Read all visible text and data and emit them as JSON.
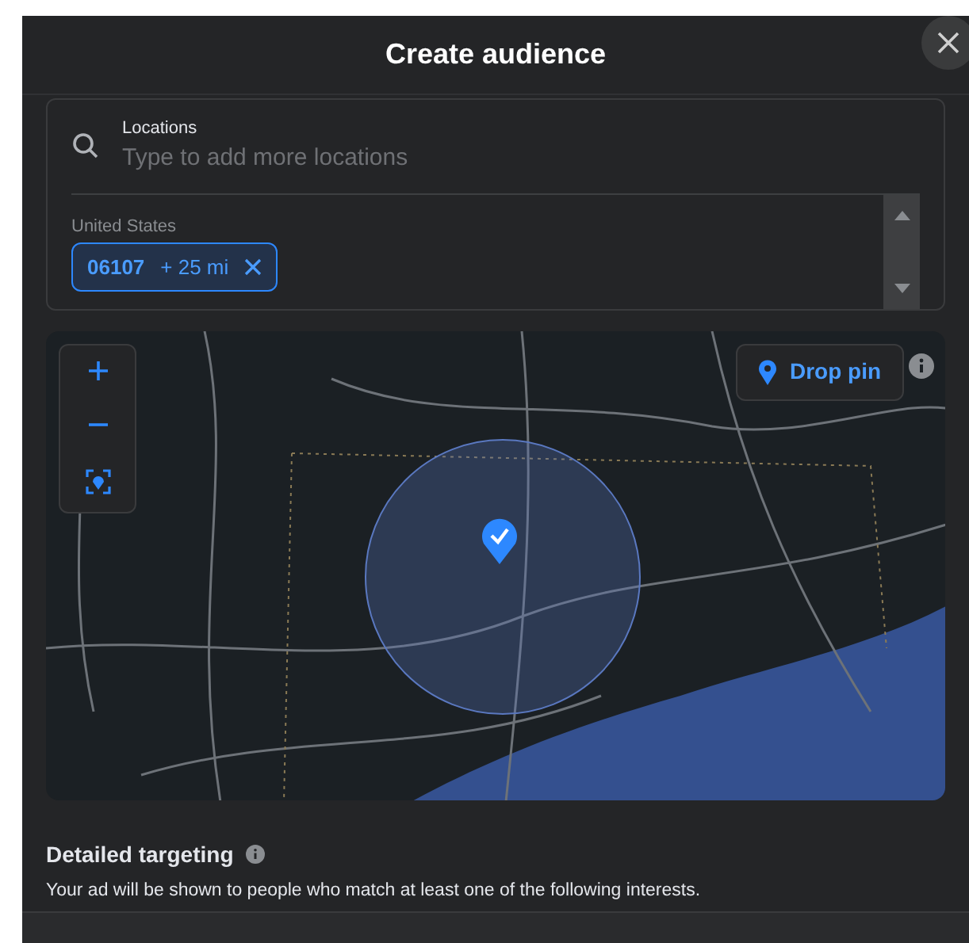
{
  "dialog": {
    "title": "Create audience"
  },
  "locations": {
    "label": "Locations",
    "placeholder": "Type to add more locations",
    "country": "United States",
    "chips": [
      {
        "code": "06107",
        "radius": "+ 25 mi"
      }
    ]
  },
  "map": {
    "drop_pin": "Drop pin"
  },
  "detailed_targeting": {
    "title": "Detailed targeting",
    "description": "Your ad will be shown to people who match at least one of the following interests."
  }
}
